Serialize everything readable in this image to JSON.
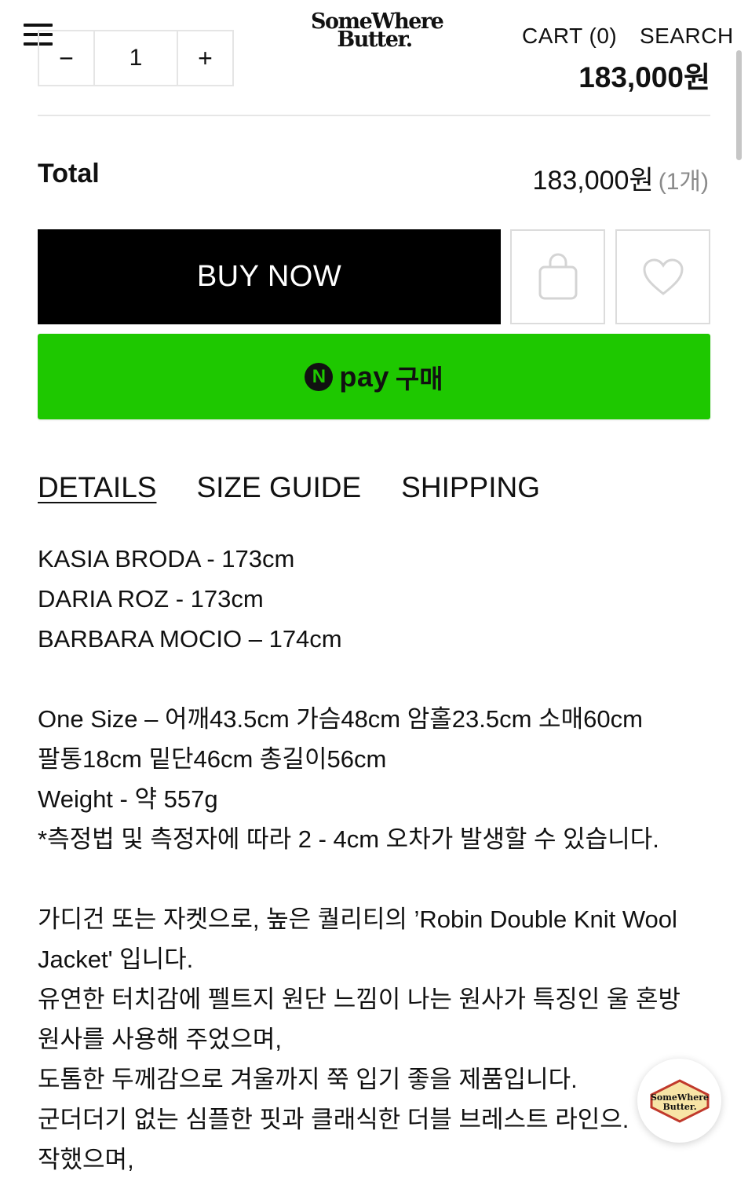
{
  "header": {
    "logo_line1": "SomeWhere",
    "logo_line2": "Butter.",
    "cart_label": "CART (0)",
    "search_label": "SEARCH",
    "price": "183,000원"
  },
  "quantity": {
    "minus": "−",
    "value": "1",
    "plus": "+"
  },
  "total": {
    "label": "Total",
    "amount": "183,000원",
    "count": "(1개)"
  },
  "actions": {
    "buy_now": "BUY NOW",
    "cart_icon": "shopping-bag-icon",
    "wish_icon": "heart-icon",
    "npay_n": "N",
    "npay_pay": "pay",
    "npay_buy": "구매"
  },
  "tabs": [
    {
      "label": "DETAILS",
      "active": true
    },
    {
      "label": "SIZE GUIDE",
      "active": false
    },
    {
      "label": "SHIPPING",
      "active": false
    }
  ],
  "details": {
    "models": [
      "KASIA BRODA - 173cm",
      "DARIA ROZ - 173cm",
      "BARBARA MOCIO – 174cm"
    ],
    "size": [
      "One Size – 어깨43.5cm 가슴48cm 암홀23.5cm 소매60cm",
      "팔통18cm 밑단46cm 총길이56cm",
      "Weight - 약 557g",
      "*측정법 및 측정자에 따라 2 - 4cm 오차가 발생할 수 있습니다."
    ],
    "description": [
      "가디건 또는 자켓으로, 높은 퀄리티의 ’Robin Double Knit Wool",
      "Jacket' 입니다.",
      "유연한 터치감에 펠트지 원단 느낌이 나는 원사가 특징인 울 혼방",
      "원사를 사용해 주었으며,",
      "도톰한 두께감으로 겨울까지 쭉 입기 좋을 제품입니다.",
      "군더더기 없는 심플한 핏과 클래식한 더블 브레스트 라인으.",
      "작했으며,"
    ]
  },
  "chat": {
    "logo_line1": "SomeWhere",
    "logo_line2": "Butter."
  },
  "colors": {
    "npay_green": "#1ec800",
    "buy_now_bg": "#000000",
    "divider": "#e6e6e6"
  }
}
